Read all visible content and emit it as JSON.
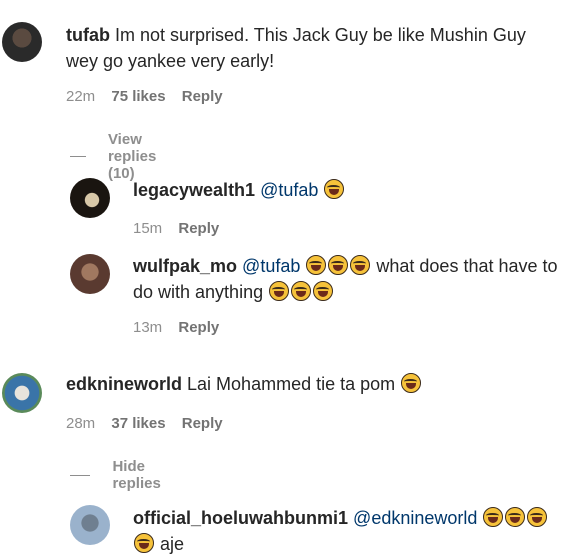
{
  "comments": [
    {
      "username": "tufab",
      "text": "Im not surprised. This Jack Guy be like Mushin Guy wey go yankee very early!",
      "time": "22m",
      "likes": "75 likes",
      "reply": "Reply",
      "toggle": "View replies (10)"
    },
    {
      "username": "legacywealth1",
      "mention": "@tufab",
      "emoji": "face-with-tears-of-joy",
      "time": "15m",
      "reply": "Reply"
    },
    {
      "username": "wulfpak_mo",
      "mention": "@tufab",
      "text_after_emoji": "what does that have to do with anything",
      "time": "13m",
      "reply": "Reply"
    },
    {
      "username": "edknineworld",
      "text": "Lai Mohammed tie ta pom",
      "time": "28m",
      "likes": "37 likes",
      "reply": "Reply",
      "toggle": "Hide replies"
    },
    {
      "username": "official_hoeluwahbunmi1",
      "mention": "@edknineworld",
      "text_after_emoji": "aje"
    }
  ],
  "colors": {
    "avatar_tufab": "#3a3a3a",
    "avatar_legacywealth1": "#1f1a14",
    "avatar_wulfpak_mo": "#7a5a4a",
    "avatar_edknineworld": "#4f7a9a",
    "avatar_official_hoeluwahbunmi1": "#8aa6c4"
  }
}
